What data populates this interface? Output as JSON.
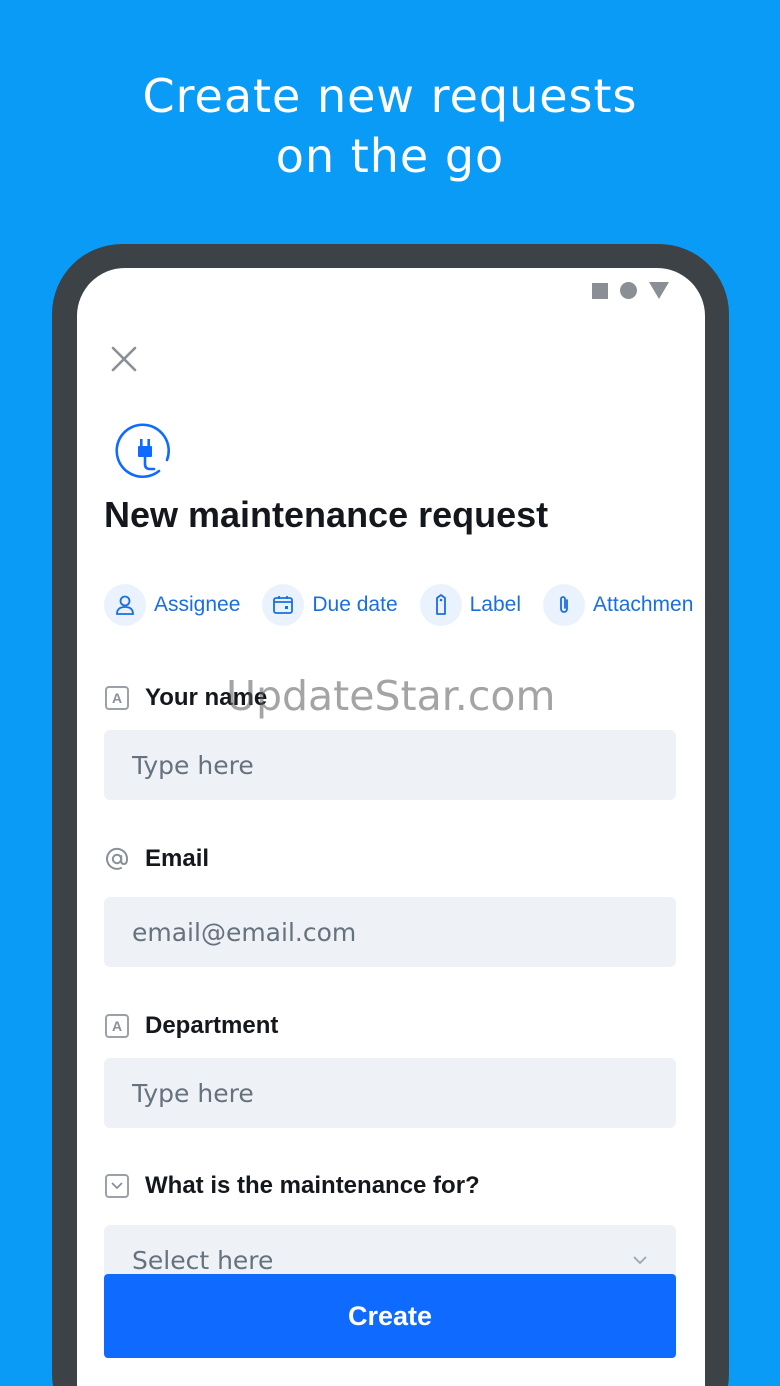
{
  "headline": {
    "line1": "Create new requests",
    "line2": "on the go"
  },
  "colors": {
    "background": "#0a9bf7",
    "primary": "#0f6bff",
    "chip_text": "#1a6fe0"
  },
  "form": {
    "title": "New maintenance request",
    "app_icon": "plug-icon",
    "chips": [
      {
        "label": "Assignee",
        "icon": "person-icon"
      },
      {
        "label": "Due date",
        "icon": "calendar-icon"
      },
      {
        "label": "Label",
        "icon": "tag-icon"
      },
      {
        "label": "Attachmen",
        "icon": "paperclip-icon"
      }
    ],
    "fields": [
      {
        "label": "Your name",
        "placeholder": "Type here",
        "icon": "text-field-icon"
      },
      {
        "label": "Email",
        "placeholder": "email@email.com",
        "icon": "at-sign-icon"
      },
      {
        "label": "Department",
        "placeholder": "Type here",
        "icon": "text-field-icon"
      },
      {
        "label": "What is the maintenance for?",
        "placeholder": "Select here",
        "icon": "dropdown-field-icon"
      }
    ],
    "submit_label": "Create"
  },
  "watermark": "UpdateStar.com"
}
